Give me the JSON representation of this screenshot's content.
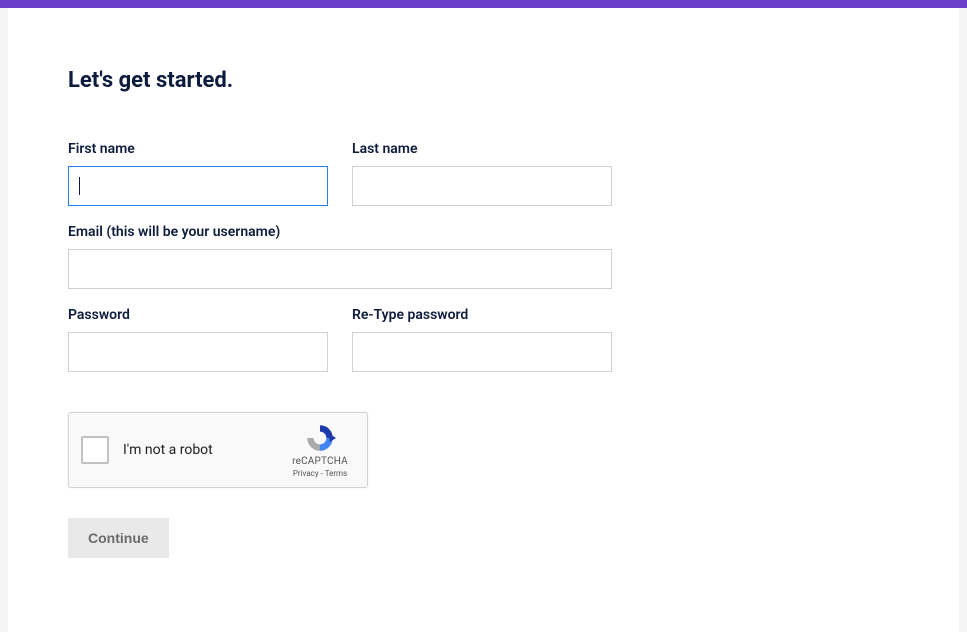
{
  "page": {
    "title": "Let's get started."
  },
  "form": {
    "first_name": {
      "label": "First name",
      "value": ""
    },
    "last_name": {
      "label": "Last name",
      "value": ""
    },
    "email": {
      "label": "Email (this will be your username)",
      "value": ""
    },
    "password": {
      "label": "Password",
      "value": ""
    },
    "retype_password": {
      "label": "Re-Type password",
      "value": ""
    }
  },
  "captcha": {
    "label": "I'm not a robot",
    "brand": "reCAPTCHA",
    "privacy": "Privacy",
    "terms": "Terms",
    "separator": " - "
  },
  "actions": {
    "continue": "Continue"
  }
}
